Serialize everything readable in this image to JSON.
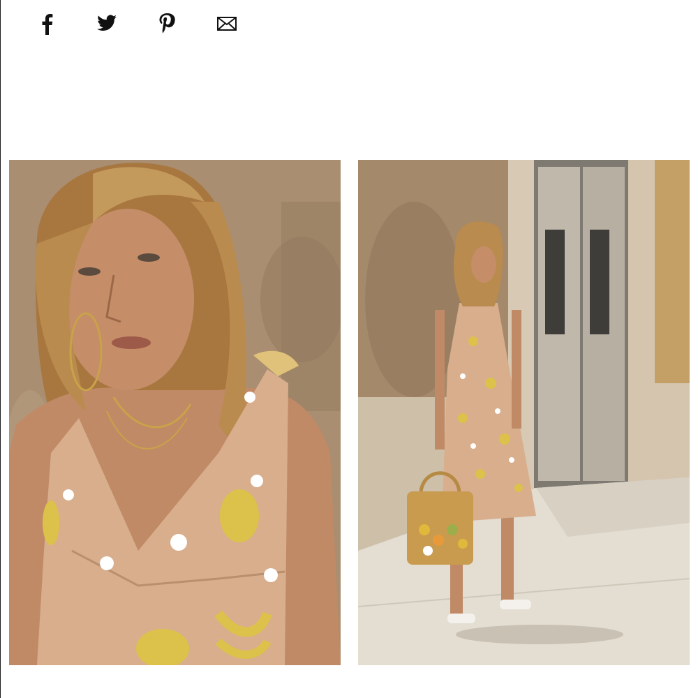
{
  "share": {
    "buttons": [
      {
        "name": "facebook",
        "icon": "facebook-icon"
      },
      {
        "name": "twitter",
        "icon": "twitter-icon"
      },
      {
        "name": "pinterest",
        "icon": "pinterest-icon"
      },
      {
        "name": "email",
        "icon": "envelope-icon"
      }
    ],
    "icon_color": "#111111"
  },
  "gallery": {
    "images": [
      {
        "subject": "portrait-closeup",
        "alt": ""
      },
      {
        "subject": "full-length-street",
        "alt": ""
      }
    ]
  },
  "colors": {
    "dress": "#d8ae8c",
    "fruit_yellow": "#dcc24a",
    "wall": "#b49c7e",
    "hair": "#b98b4e",
    "skin": "#c08a66"
  }
}
